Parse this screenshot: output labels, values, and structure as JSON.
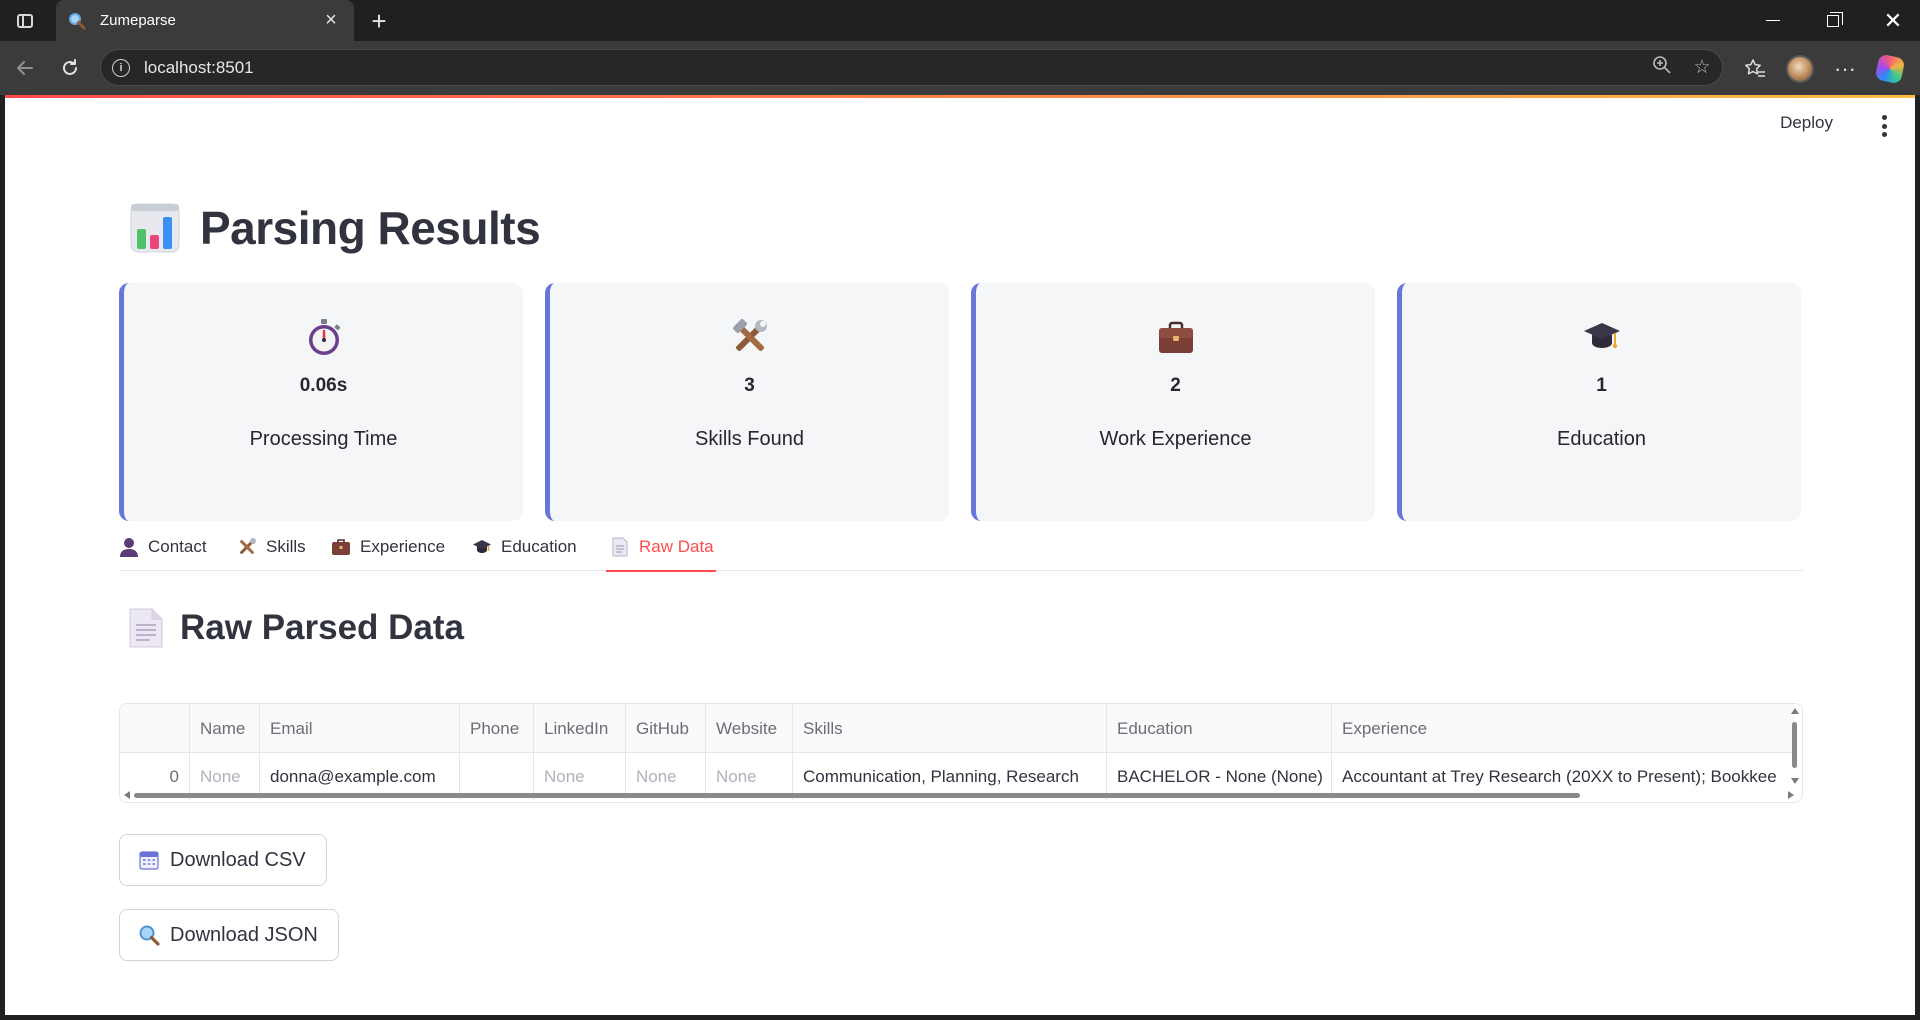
{
  "browser": {
    "tab_title": "Zumeparse",
    "url": "localhost:8501"
  },
  "app": {
    "deploy_label": "Deploy",
    "page_title": "Parsing Results",
    "metrics": [
      {
        "icon": "stopwatch-icon",
        "value": "0.06s",
        "label": "Processing Time"
      },
      {
        "icon": "tools-icon",
        "value": "3",
        "label": "Skills Found"
      },
      {
        "icon": "briefcase-icon",
        "value": "2",
        "label": "Work Experience"
      },
      {
        "icon": "graduation-cap-icon",
        "value": "1",
        "label": "Education"
      }
    ],
    "tabs": [
      {
        "icon": "person-icon",
        "label": "Contact",
        "active": false
      },
      {
        "icon": "tools-icon",
        "label": "Skills",
        "active": false
      },
      {
        "icon": "briefcase-icon",
        "label": "Experience",
        "active": false
      },
      {
        "icon": "graduation-cap-icon",
        "label": "Education",
        "active": false
      },
      {
        "icon": "document-icon",
        "label": "Raw Data",
        "active": true
      }
    ],
    "section_title": "Raw Parsed Data",
    "table": {
      "columns": [
        "",
        "Name",
        "Email",
        "Phone",
        "LinkedIn",
        "GitHub",
        "Website",
        "Skills",
        "Education",
        "Experience"
      ],
      "rows": [
        [
          "0",
          "None",
          "donna@example.com",
          "",
          "None",
          "None",
          "None",
          "Communication, Planning, Research",
          "BACHELOR - None (None)",
          "Accountant at Trey Research (20XX to Present); Bookkee"
        ]
      ]
    },
    "download_csv_label": "Download CSV",
    "download_json_label": "Download JSON",
    "colors": {
      "accent": "#ff4b4b",
      "card_border": "#6677d9",
      "card_bg": "#f5f6f8",
      "text": "#31333f"
    }
  }
}
